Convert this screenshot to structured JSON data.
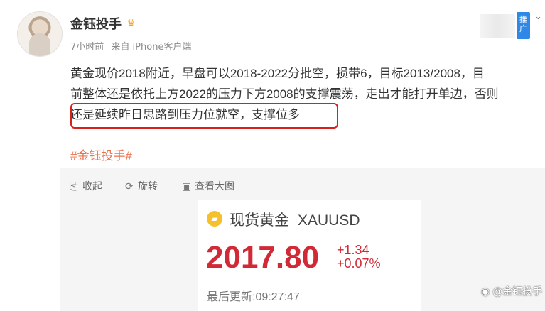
{
  "post": {
    "username": "金钰投手",
    "badge_icon": "crown-icon",
    "time": "7小时前",
    "source": "来自 iPhone客户端",
    "promo_label": "推广",
    "line1": "黄金现价2018附近，早盘可以2018-2022分批空，损带6，目标2013/2008，目",
    "line2": "前整体还是依托上方2022的压力下方2008的支撑震荡，走出才能打开单边，否则",
    "line3": "还是延续昨日思路到压力位就空，支撑位多",
    "hashtag": "#金钰投手#"
  },
  "toolbar": {
    "collapse": "收起",
    "rotate": "旋转",
    "view_large": "查看大图"
  },
  "stock": {
    "name": "现货黄金",
    "symbol": "XAUUSD",
    "price": "2017.80",
    "change_abs": "+1.34",
    "change_pct": "+0.07%",
    "last_update": "最后更新:09:27:47",
    "color_up": "#d12a36"
  },
  "watermark": {
    "text": "@金钰投手"
  }
}
